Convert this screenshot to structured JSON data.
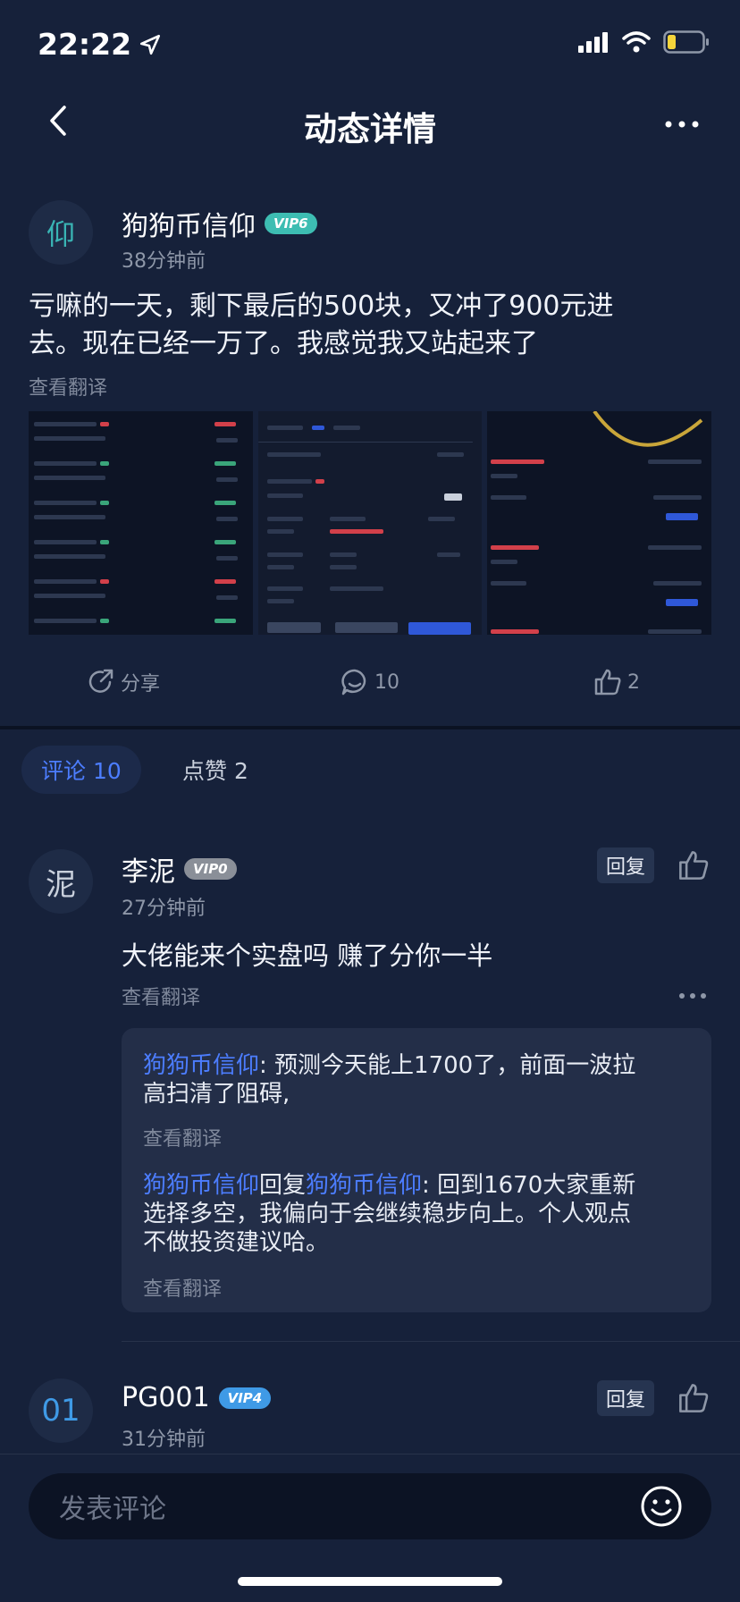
{
  "status_bar": {
    "time": "22:22",
    "icons": [
      "location-arrow-icon",
      "signal-icon",
      "wifi-icon",
      "battery-icon"
    ]
  },
  "nav": {
    "title": "动态详情",
    "back_icon": "chevron-left-icon",
    "more_icon": "more-horizontal-icon"
  },
  "post": {
    "avatar_char": "仰",
    "author": "狗狗币信仰",
    "vip_badge": "VIP6",
    "time": "38分钟前",
    "content_line1": "亏嘛的一天，剩下最后的500块，又冲了900元进",
    "content_line2": "去。现在已经一万了。我感觉我又站起来了",
    "translate_label": "查看翻译"
  },
  "actions": {
    "share_label": "分享",
    "comments_count": "10",
    "likes_count": "2"
  },
  "tabs": {
    "comments": "评论 10",
    "likes": "点赞 2"
  },
  "comments": [
    {
      "avatar_char": "泥",
      "name": "李泥",
      "vip_badge": "VIP0",
      "time": "27分钟前",
      "text": "大佬能来个实盘吗 赚了分你一半",
      "translate_label": "查看翻译",
      "reply_label": "回复"
    },
    {
      "avatar_char": "01",
      "name": "PG001",
      "vip_badge": "VIP4",
      "time": "31分钟前",
      "reply_label": "回复"
    }
  ],
  "replies": [
    {
      "author": "狗狗币信仰",
      "text_line1": ": 预测今天能上1700了，前面一波拉",
      "text_line2": "高扫清了阻碍,",
      "translate_label": "查看翻译"
    },
    {
      "author": "狗狗币信仰",
      "reply_word": "回复",
      "target": "狗狗币信仰",
      "text_line1": ": 回到1670大家重新",
      "text_line2": "选择多空，我偏向于会继续稳步向上。个人观点",
      "text_line3": "不做投资建议哈。",
      "translate_label": "查看翻译"
    }
  ],
  "input": {
    "placeholder": "发表评论"
  },
  "colors": {
    "background": "#16213a",
    "accent": "#4c7dff",
    "vip6": "#3dbdb2",
    "vip4": "#3f9ae6"
  }
}
